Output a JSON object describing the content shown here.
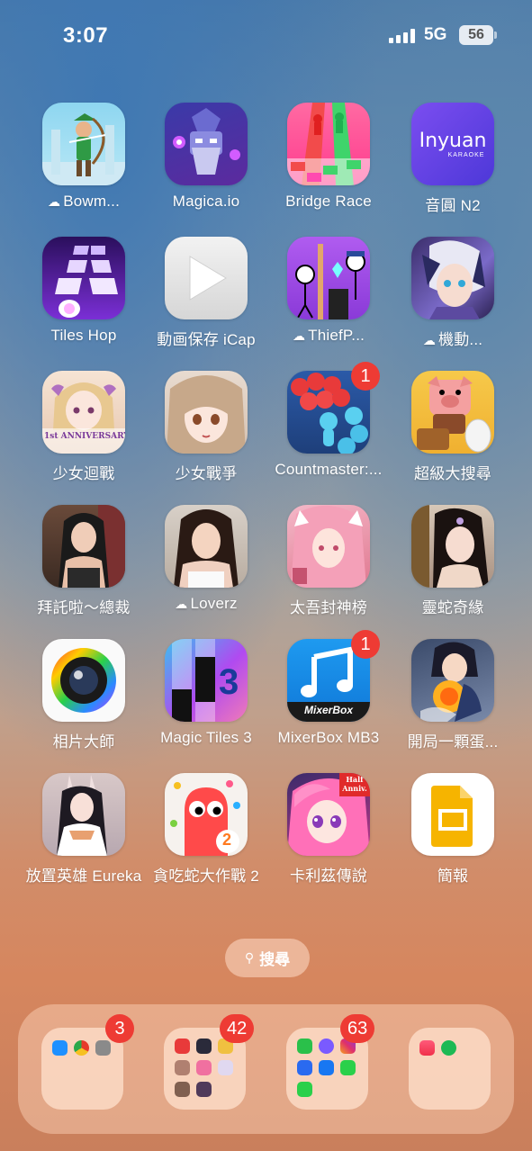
{
  "status_bar": {
    "time": "3:07",
    "network": "5G",
    "battery": "56"
  },
  "apps": [
    {
      "label": "Bowm...",
      "cloud": true,
      "badge": ""
    },
    {
      "label": "Magica.io",
      "cloud": false,
      "badge": ""
    },
    {
      "label": "Bridge Race",
      "cloud": false,
      "badge": ""
    },
    {
      "label": "音圓 N2",
      "cloud": false,
      "badge": ""
    },
    {
      "label": "Tiles Hop",
      "cloud": false,
      "badge": ""
    },
    {
      "label": "動画保存 iCap",
      "cloud": false,
      "badge": ""
    },
    {
      "label": "ThiefP...",
      "cloud": true,
      "badge": ""
    },
    {
      "label": "機動...",
      "cloud": true,
      "badge": ""
    },
    {
      "label": "少女迴戰",
      "cloud": false,
      "badge": ""
    },
    {
      "label": "少女戰爭",
      "cloud": false,
      "badge": ""
    },
    {
      "label": "Countmaster:...",
      "cloud": false,
      "badge": "1"
    },
    {
      "label": "超級大搜尋",
      "cloud": false,
      "badge": ""
    },
    {
      "label": "拜託啦～總裁",
      "cloud": false,
      "badge": ""
    },
    {
      "label": "Loverz",
      "cloud": true,
      "badge": ""
    },
    {
      "label": "太吾封神榜",
      "cloud": false,
      "badge": ""
    },
    {
      "label": "靈蛇奇緣",
      "cloud": false,
      "badge": ""
    },
    {
      "label": "相片大師",
      "cloud": false,
      "badge": ""
    },
    {
      "label": "Magic Tiles 3",
      "cloud": false,
      "badge": ""
    },
    {
      "label": "MixerBox MB3",
      "cloud": false,
      "badge": "1"
    },
    {
      "label": "開局一顆蛋...",
      "cloud": false,
      "badge": ""
    },
    {
      "label": "放置英雄 Eureka",
      "cloud": false,
      "badge": ""
    },
    {
      "label": "貪吃蛇大作戰 2",
      "cloud": false,
      "badge": ""
    },
    {
      "label": "卡利茲傳說",
      "cloud": false,
      "badge": ""
    },
    {
      "label": "簡報",
      "cloud": false,
      "badge": ""
    }
  ],
  "icon_text": {
    "inyuan": "Inyuan",
    "karaoke": "KARAOKE",
    "anniv": "1st ANNIVERSARY",
    "mixerbox": "MixerBox",
    "magic_tiles_num": "3",
    "snake_num": "2",
    "half_anniv": "Half Anniv."
  },
  "search": {
    "label": "搜尋"
  },
  "dock": {
    "badges": [
      "3",
      "42",
      "63",
      ""
    ]
  }
}
